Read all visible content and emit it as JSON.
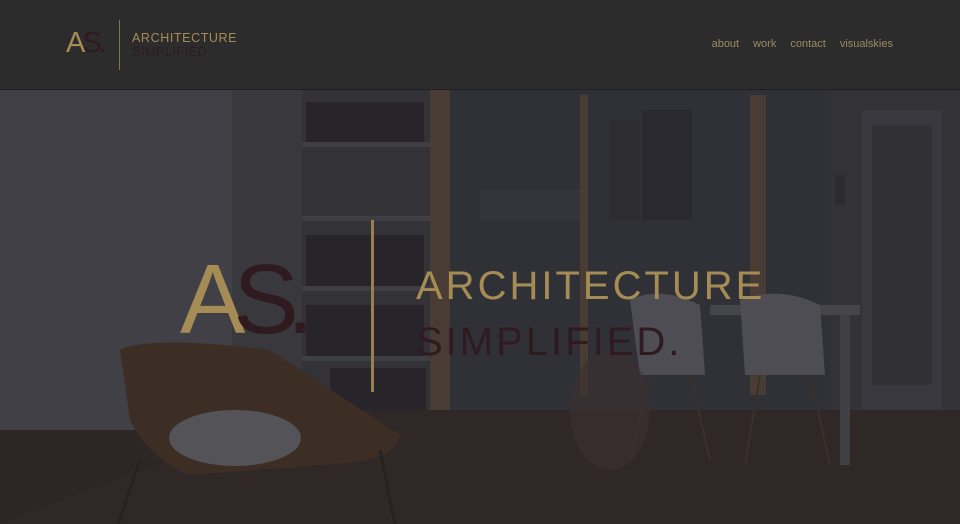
{
  "header": {
    "logo": {
      "mark_a": "A",
      "mark_s": "S",
      "mark_dot": ".",
      "line1": "ARCHITECTURE",
      "line2": "SIMPLIFIED."
    },
    "nav": [
      "about",
      "work",
      "contact",
      "visualskies"
    ]
  },
  "hero": {
    "logo": {
      "mark_a": "A",
      "mark_s": "S",
      "mark_dot": ".",
      "line1": "ARCHITECTURE",
      "line2": "SIMPLIFIED."
    }
  },
  "colors": {
    "header_bg": "#2c2c2c",
    "gold": "#a58c55",
    "maroon": "#2f1a20",
    "nav": "#9c8a62"
  }
}
